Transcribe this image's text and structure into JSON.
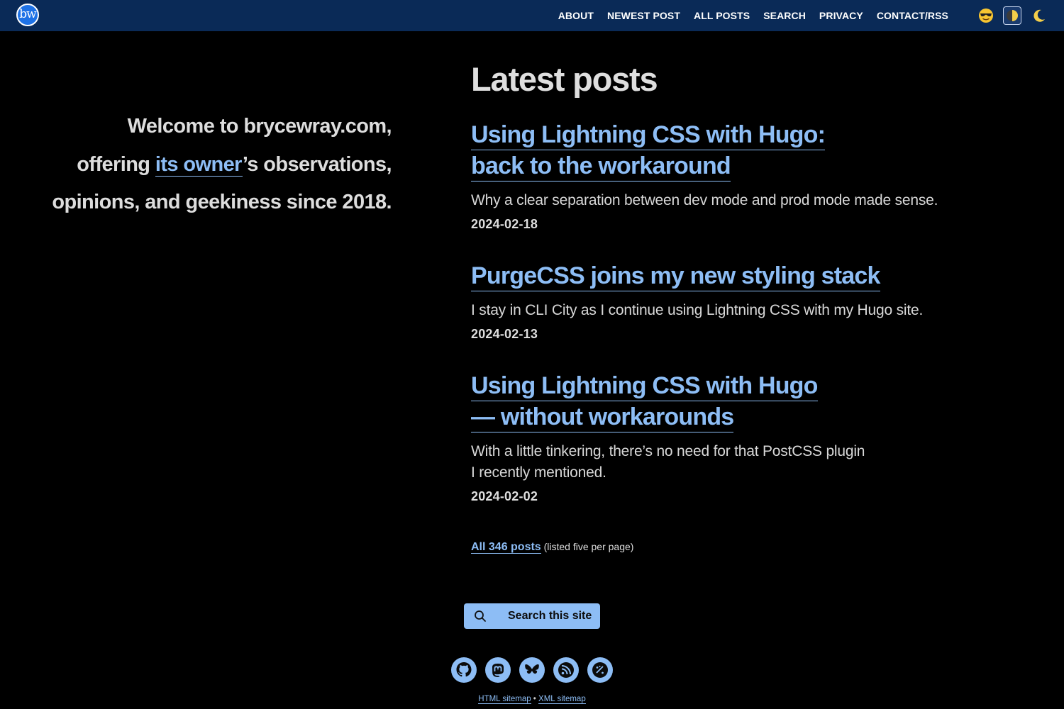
{
  "nav": {
    "logo_text": "bw",
    "items": [
      {
        "label": "ABOUT"
      },
      {
        "label": "NEWEST POST"
      },
      {
        "label": "ALL POSTS"
      },
      {
        "label": "SEARCH"
      },
      {
        "label": "PRIVACY"
      },
      {
        "label": "CONTACT/RSS"
      }
    ],
    "modes": {
      "light_icon": "sunglasses-icon",
      "auto_icon": "half-moon-icon",
      "dark_icon": "crescent-moon-icon",
      "selected": "auto"
    }
  },
  "intro": {
    "line1": "Welcome to brycewray.com,",
    "pre_link": "offering ",
    "link": "its owner",
    "post_link": "’s observations,",
    "line3": "opinions, and geekiness since 2018."
  },
  "main": {
    "heading": "Latest posts",
    "posts": [
      {
        "title_lines": [
          "Using Lightning CSS with Hugo:",
          "back to the workaround"
        ],
        "description": "Why a clear separation between dev mode and prod mode made sense.",
        "date": "2024-02-18"
      },
      {
        "title_lines": [
          "PurgeCSS joins my new styling stack"
        ],
        "description": "I stay in CLI City as I continue using Lightning CSS with my Hugo site.",
        "date": "2024-02-13"
      },
      {
        "title_lines": [
          "Using Lightning CSS with Hugo",
          "— without workarounds"
        ],
        "description_lines": [
          "With a little tinkering, there’s no need for that PostCSS plugin",
          "I recently mentioned."
        ],
        "date": "2024-02-02"
      }
    ],
    "all_posts_link": "All 346 posts",
    "all_posts_note": " (listed five per page)"
  },
  "footer": {
    "search_label": "Search this site",
    "social_icons": [
      "github-icon",
      "mastodon-icon",
      "bluesky-icon",
      "rss-icon",
      "satellite-icon"
    ],
    "html_sitemap": "HTML sitemap",
    "separator": " • ",
    "xml_sitemap": "XML sitemap"
  },
  "colors": {
    "nav_bg": "#0a2a57",
    "link": "#8dbdf5",
    "page_bg": "#000000"
  }
}
